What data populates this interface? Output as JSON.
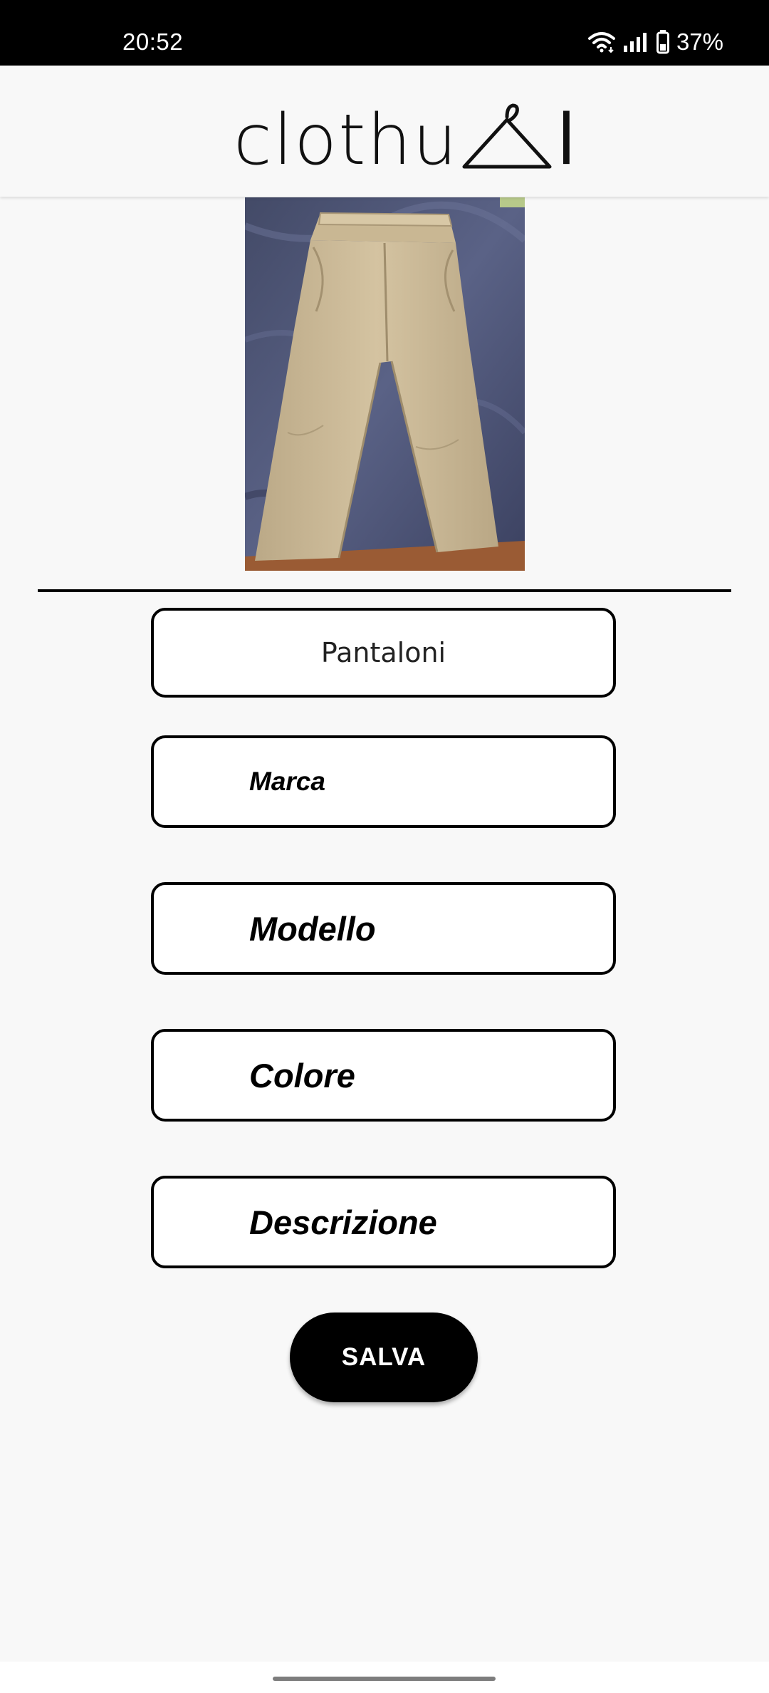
{
  "status_bar": {
    "time": "20:52",
    "battery_percent": "37%",
    "icons": [
      "wifi-icon",
      "signal-icon",
      "battery-icon"
    ]
  },
  "header": {
    "logo_text": "clothu",
    "logo_suffix": "l",
    "logo_icon": "hanger-icon"
  },
  "photo": {
    "subject": "beige-pants-photo"
  },
  "form": {
    "category_value": "Pantaloni",
    "brand_placeholder": "Marca",
    "model_placeholder": "Modello",
    "color_placeholder": "Colore",
    "description_placeholder": "Descrizione",
    "save_label": "SALVA"
  },
  "colors": {
    "background": "#f8f8f8",
    "accent": "#000000",
    "field_background": "#ffffff"
  }
}
